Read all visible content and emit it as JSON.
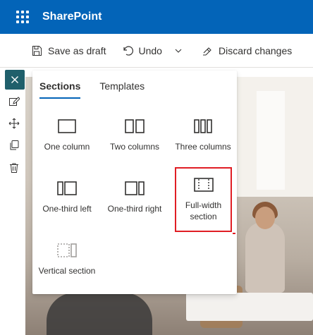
{
  "suitebar": {
    "brand": "SharePoint"
  },
  "commandbar": {
    "save_draft": "Save as draft",
    "undo": "Undo",
    "discard": "Discard changes"
  },
  "panel": {
    "tabs": [
      {
        "label": "Sections",
        "active": true
      },
      {
        "label": "Templates",
        "active": false
      }
    ],
    "layouts": [
      {
        "label": "One column"
      },
      {
        "label": "Two columns"
      },
      {
        "label": "Three columns"
      },
      {
        "label": "One-third left"
      },
      {
        "label": "One-third right"
      },
      {
        "label": "Full-width section",
        "highlighted": true
      },
      {
        "label": "Vertical section"
      }
    ]
  },
  "colors": {
    "suitebar": "#0364b8",
    "accent": "#0364b8",
    "close_button": "#1f5f6b",
    "highlight": "#e01e24"
  },
  "icons": [
    "waffle-icon",
    "save-icon",
    "undo-icon",
    "chevron-down-icon",
    "discard-icon",
    "gear-icon",
    "close-icon",
    "edit-icon",
    "move-icon",
    "duplicate-icon",
    "delete-icon"
  ]
}
